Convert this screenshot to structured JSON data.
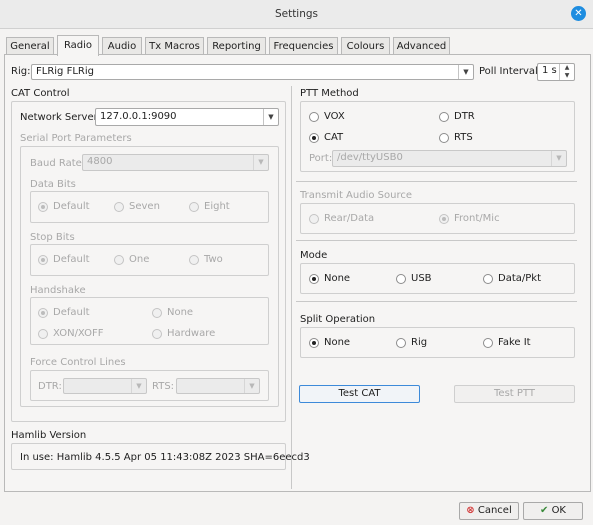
{
  "window": {
    "title": "Settings"
  },
  "tabs": [
    {
      "label": "General"
    },
    {
      "label": "Radio"
    },
    {
      "label": "Audio"
    },
    {
      "label": "Tx Macros"
    },
    {
      "label": "Reporting"
    },
    {
      "label": "Frequencies"
    },
    {
      "label": "Colours"
    },
    {
      "label": "Advanced"
    }
  ],
  "rig": {
    "label": "Rig:",
    "value": "FLRig FLRig",
    "poll_label": "Poll Interval:",
    "poll_value": "1 s"
  },
  "cat": {
    "title": "CAT Control",
    "network_server_label": "Network Server:",
    "network_server_value": "127.0.0.1:9090",
    "serial_title": "Serial Port Parameters",
    "baud_label": "Baud Rate:",
    "baud_value": "4800",
    "data_bits_title": "Data Bits",
    "data_bits": [
      "Default",
      "Seven",
      "Eight"
    ],
    "stop_bits_title": "Stop Bits",
    "stop_bits": [
      "Default",
      "One",
      "Two"
    ],
    "handshake_title": "Handshake",
    "handshake": [
      "Default",
      "None",
      "XON/XOFF",
      "Hardware"
    ],
    "force_title": "Force Control Lines",
    "dtr_label": "DTR:",
    "rts_label": "RTS:"
  },
  "hamlib": {
    "title": "Hamlib Version",
    "text": "In use:  Hamlib 4.5.5 Apr 05 11:43:08Z 2023 SHA=6eecd3"
  },
  "ptt": {
    "title": "PTT Method",
    "options": [
      "VOX",
      "DTR",
      "CAT",
      "RTS"
    ],
    "selected": "CAT",
    "port_label": "Port:",
    "port_value": "/dev/ttyUSB0"
  },
  "audio_source": {
    "title": "Transmit Audio Source",
    "options": [
      "Rear/Data",
      "Front/Mic"
    ],
    "selected": "Front/Mic"
  },
  "mode": {
    "title": "Mode",
    "options": [
      "None",
      "USB",
      "Data/Pkt"
    ],
    "selected": "None"
  },
  "split": {
    "title": "Split Operation",
    "options": [
      "None",
      "Rig",
      "Fake It"
    ],
    "selected": "None"
  },
  "buttons": {
    "test_cat": "Test CAT",
    "test_ptt": "Test PTT",
    "cancel": "Cancel",
    "ok": "OK"
  },
  "colors": {
    "accent": "#1e8de0",
    "focus": "#3d8ad9"
  }
}
